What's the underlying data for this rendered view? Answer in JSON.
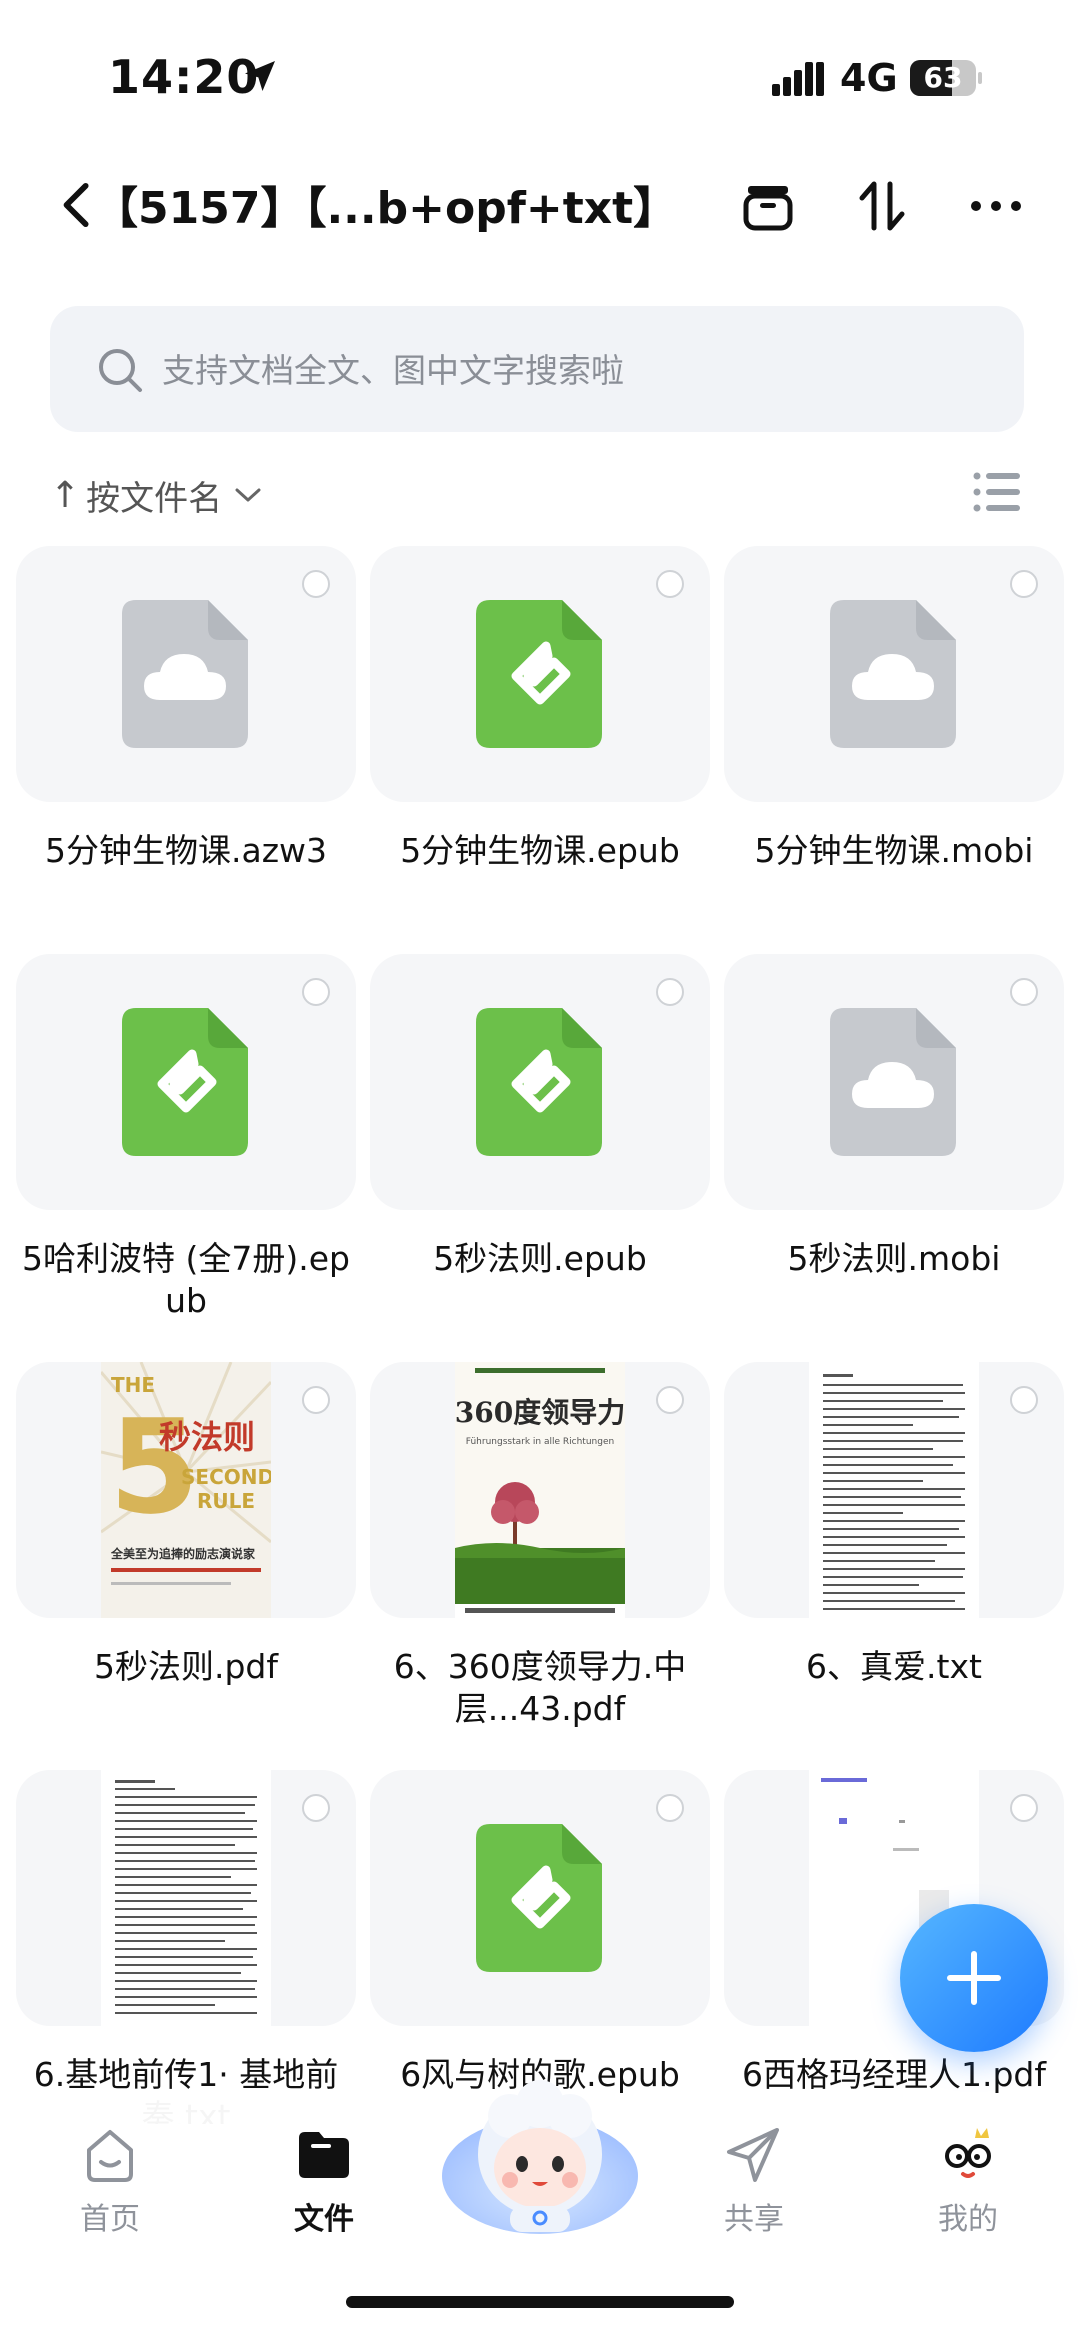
{
  "status_bar": {
    "time": "14:20",
    "network": "4G",
    "battery": "63",
    "battery_level": 0.63
  },
  "navbar": {
    "title": "【5157】【...b+opf+txt】"
  },
  "search": {
    "placeholder": "支持文档全文、图中文字搜索啦"
  },
  "sort": {
    "label": "按文件名"
  },
  "files": [
    {
      "name": "5分钟生物课.azw3",
      "type": "cloud"
    },
    {
      "name": "5分钟生物课.epub",
      "type": "epub"
    },
    {
      "name": "5分钟生物课.mobi",
      "type": "cloud"
    },
    {
      "name": "5哈利波特 (全7册).epub",
      "type": "epub"
    },
    {
      "name": "5秒法则.epub",
      "type": "epub"
    },
    {
      "name": "5秒法则.mobi",
      "type": "cloud"
    },
    {
      "name": "5秒法则.pdf",
      "type": "pdf-cover-5sec"
    },
    {
      "name": "6、360度领导力.中层...43.pdf",
      "type": "pdf-cover-360"
    },
    {
      "name": "6、真爱.txt",
      "type": "text-doc"
    },
    {
      "name": "6.基地前传1· 基地前奏.txt",
      "type": "text-doc"
    },
    {
      "name": "6风与树的歌.epub",
      "type": "epub"
    },
    {
      "name": "6西格玛经理人1.pdf",
      "type": "pdf-doc"
    }
  ],
  "covers": {
    "five_second": {
      "big": "5",
      "title": "秒法则",
      "en1": "SECOND",
      "en2": "RULE",
      "top": "THE",
      "blurb": "全美至为追捧的励志演说家"
    },
    "leadership": {
      "title": "360度领导力",
      "sub": "Führungsstark in alle Richtungen"
    }
  },
  "tabs": [
    {
      "label": "首页"
    },
    {
      "label": "文件"
    },
    {
      "label": "共享"
    },
    {
      "label": "我的"
    }
  ],
  "colors": {
    "accent": "#1e7bff",
    "epub_green": "#6cc04a",
    "cloud_gray": "#c6c9ce"
  }
}
